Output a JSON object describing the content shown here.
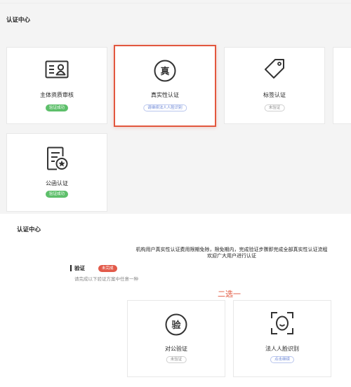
{
  "section1": {
    "title": "认证中心",
    "cards": [
      {
        "label": "主体资质审核",
        "status": "验证成功",
        "icon": "id-card-icon"
      },
      {
        "label": "真实性认证",
        "status": "请继续法人人脸识别",
        "icon": "zhen-char-icon"
      },
      {
        "label": "标签认证",
        "status": "未验证",
        "icon": "tag-icon"
      },
      {
        "label": "公函认证",
        "status": "验证成功",
        "icon": "document-star-icon"
      }
    ]
  },
  "section2": {
    "title": "认证中心",
    "notice_line1": "机构用户真实性认证费用限期免除，限免期内，完成验证步骤即完成全部真实性认证流程",
    "notice_line2": "欢迎广大用户进行认证",
    "verify_label": "验证",
    "verify_badge": "未完成",
    "verify_sub": "请完成以下验证方案中任意一种",
    "pick_label": "二选一",
    "options": [
      {
        "label": "对公验证",
        "status": "未验证",
        "icon_char": "验",
        "icon": "yan-char-icon"
      },
      {
        "label": "法人人脸识别",
        "status": "点击继续",
        "icon": "face-scan-icon"
      }
    ]
  },
  "colors": {
    "accent": "#e2573e",
    "success": "#5dbf6a",
    "link": "#6b86d6"
  }
}
